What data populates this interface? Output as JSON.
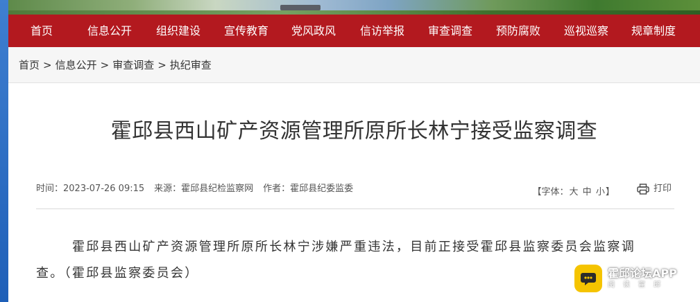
{
  "nav": {
    "items": [
      "首页",
      "信息公开",
      "组织建设",
      "宣传教育",
      "党风政风",
      "信访举报",
      "审查调查",
      "预防腐败",
      "巡视巡察",
      "规章制度"
    ]
  },
  "breadcrumb": [
    "首页",
    "信息公开",
    "审查调查",
    "执纪审查"
  ],
  "breadcrumb_separator": ">",
  "article": {
    "title": "霍邱县西山矿产资源管理所原所长林宁接受监察调查",
    "meta": {
      "time": "时间：2023-07-26 09:15",
      "source": "来源：霍邱县纪检监察网",
      "author": "作者：霍邱县纪委监委"
    },
    "font_size": {
      "open": "【字体：",
      "large": "大",
      "medium": "中",
      "small": "小",
      "close": "】"
    },
    "print_label": "打印",
    "body": "霍邱县西山矿产资源管理所原所长林宁涉嫌严重违法，目前正接受霍邱县监察委员会监察调查。（霍邱县监察委员会）"
  },
  "app_badge": {
    "name": "霍邱论坛APP",
    "slogan": "阅读霍邱"
  },
  "colors": {
    "nav_background": "#b3191f",
    "left_strip": "#2f6fc4",
    "app_logo": "#f5c400"
  }
}
